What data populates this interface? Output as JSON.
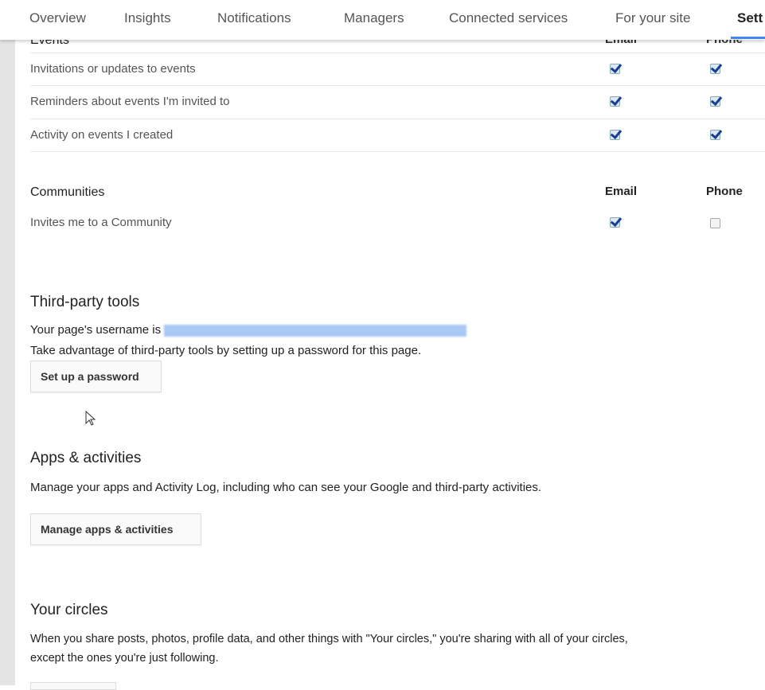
{
  "tabs": [
    "Overview",
    "Insights",
    "Notifications",
    "Managers",
    "Connected services",
    "For your site",
    "Sett"
  ],
  "active_tab": "Sett",
  "events": {
    "title": "Events",
    "email_label": "Email",
    "phone_label": "Phone",
    "rows": [
      {
        "label": "Invitations or updates to events",
        "email": true,
        "phone": true
      },
      {
        "label": "Reminders about events I'm invited to",
        "email": true,
        "phone": true
      },
      {
        "label": "Activity on events I created",
        "email": true,
        "phone": true
      }
    ]
  },
  "communities": {
    "title": "Communities",
    "email_label": "Email",
    "phone_label": "Phone",
    "rows": [
      {
        "label": "Invites me to a Community",
        "email": true,
        "phone": false
      }
    ]
  },
  "third_party": {
    "title": "Third-party tools",
    "username_prefix": "Your page's username is",
    "description": "Take advantage of third-party tools by setting up a password for this page.",
    "button": "Set up a password"
  },
  "apps": {
    "title": "Apps & activities",
    "description": "Manage your apps and Activity Log, including who can see your Google and third-party activities.",
    "button": "Manage apps & activities"
  },
  "circles": {
    "title": "Your circles",
    "description_line1": "When you share posts, photos, profile data, and other things with \"Your circles,\" you're sharing with all of your circles,",
    "description_line2": "except the ones you're just following."
  },
  "colors": {
    "accent": "#4285f4",
    "checkbox_check": "#1a3d8f"
  }
}
